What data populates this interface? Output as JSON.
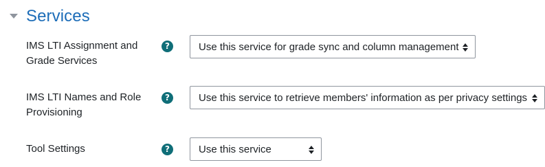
{
  "section": {
    "title": "Services",
    "collapse_icon": "caret-down-icon"
  },
  "fields": [
    {
      "label": "IMS LTI Assignment and Grade Services",
      "help_icon": "question-circle-icon",
      "help_glyph": "?",
      "selected_value": "Use this service for grade sync and column management"
    },
    {
      "label": "IMS LTI Names and Role Provisioning",
      "help_icon": "question-circle-icon",
      "help_glyph": "?",
      "selected_value": "Use this service to retrieve members' information as per privacy settings"
    },
    {
      "label": "Tool Settings",
      "help_icon": "question-circle-icon",
      "help_glyph": "?",
      "selected_value": "Use this service"
    }
  ],
  "colors": {
    "title": "#1d6db8",
    "help_icon": "#0f6e78",
    "select_border": "#8f959e",
    "text": "#1d2125"
  }
}
